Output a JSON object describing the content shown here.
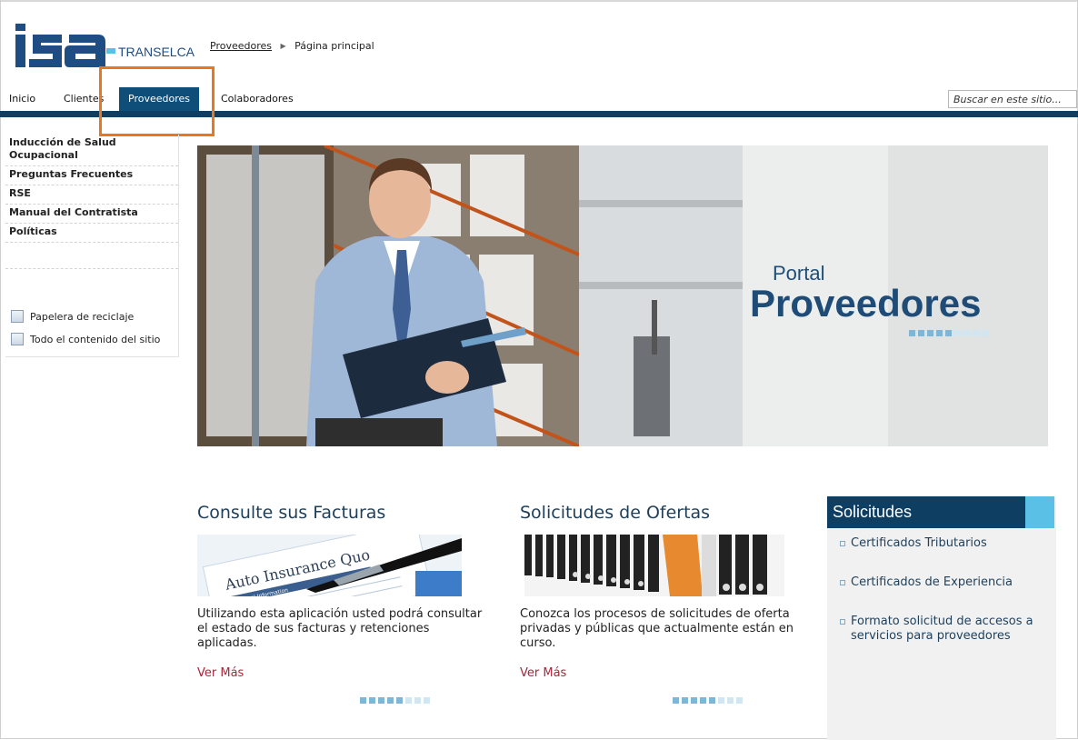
{
  "brand": {
    "logo_text": "isa",
    "company": "TRANSELCA",
    "colors": {
      "primary": "#0e3e62",
      "accent": "#5bc0e6",
      "highlight": "#e87722",
      "link_red": "#a8263a"
    }
  },
  "breadcrumb": {
    "link": "Proveedores",
    "separator_icon": "triangle-right-icon",
    "current": "Página principal"
  },
  "nav": {
    "items": [
      "Inicio",
      "Clientes",
      "Proveedores",
      "Colaboradores"
    ],
    "active": "Proveedores",
    "search_placeholder": "Buscar en este sitio..."
  },
  "sidebar": {
    "items": [
      "Inducción de Salud Ocupacional",
      "Preguntas Frecuentes",
      "RSE",
      "Manual del Contratista",
      "Políticas"
    ],
    "tools": [
      {
        "label": "Papelera de reciclaje",
        "icon": "recycle-bin-icon"
      },
      {
        "label": "Todo el contenido del sitio",
        "icon": "site-content-icon"
      }
    ]
  },
  "hero": {
    "title_line1": "Portal",
    "title_line2": "Proveedores"
  },
  "columns": [
    {
      "title": "Consulte sus Facturas",
      "image_text": "Auto Insurance Quo",
      "image_subtext": "Personal Information",
      "description": "Utilizando esta aplicación usted podrá consultar el estado de sus facturas y retenciones aplicadas.",
      "link": "Ver Más"
    },
    {
      "title": "Solicitudes de Ofertas",
      "description": "Conozca los procesos de solicitudes de oferta privadas y públicas que actualmente están en curso.",
      "link": "Ver Más"
    }
  ],
  "panel": {
    "title": "Solicitudes",
    "links": [
      "Certificados Tributarios",
      "Certificados de Experiencia",
      "Formato solicitud de accesos a servicios para proveedores"
    ]
  }
}
